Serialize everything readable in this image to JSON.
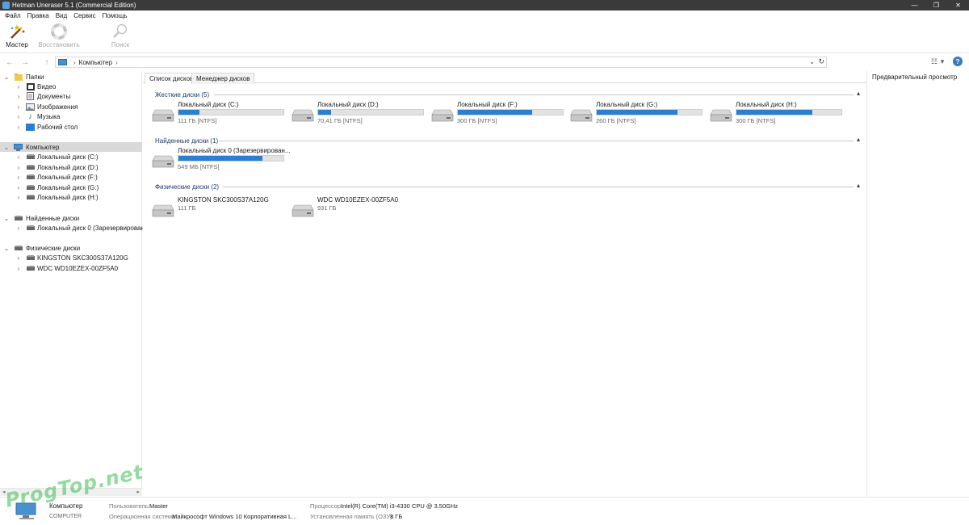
{
  "window": {
    "title": "Hetman Uneraser 5.1 (Commercial Edition)",
    "minimize_glyph": "—",
    "maximize_glyph": "❐",
    "close_glyph": "✕"
  },
  "menu": [
    "Файл",
    "Правка",
    "Вид",
    "Сервис",
    "Помощь"
  ],
  "toolbar": {
    "master_label": "Мастер",
    "restore_label": "Восстановить",
    "search_label": "Поиск"
  },
  "address": {
    "back_glyph": "←",
    "forward_glyph": "→",
    "up_glyph": "↑",
    "crumb": "Компьютер",
    "separator": "›",
    "dropdown_glyph": "⌄",
    "refresh_glyph": "↻",
    "view_glyph": "☷",
    "view_dropdown_glyph": "▾",
    "help_glyph": "?"
  },
  "sidebar": {
    "folders_label": "Папки",
    "folders": [
      "Видео",
      "Документы",
      "Изображения",
      "Музыка",
      "Рабочий стол"
    ],
    "computer_label": "Компьютер",
    "computer_disks": [
      "Локальный диск (C:)",
      "Локальный диск (D:)",
      "Локальный диск (F:)",
      "Локальный диск (G:)",
      "Локальный диск (H:)"
    ],
    "found_label": "Найденные диски",
    "found_disks": [
      "Локальный диск 0 (Зарезервировано"
    ],
    "physical_label": "Физические диски",
    "physical_disks": [
      "KINGSTON SKC300S37A120G",
      "WDC WD10EZEX-00ZF5A0"
    ],
    "expand_glyph": "›",
    "collapse_glyph": "⌄"
  },
  "tabs": [
    "Список дисков",
    "Менеджер дисков"
  ],
  "groups": {
    "hard_disks_title": "Жесткие диски (5)",
    "found_disks_title": "Найденные диски (1)",
    "physical_disks_title": "Физические диски (2)",
    "collapse_glyph": "▴"
  },
  "hard_disks": [
    {
      "name": "Локальный диск (C:)",
      "info": "111 ГБ [NTFS]",
      "fill": 0.2
    },
    {
      "name": "Локальный диск (D:)",
      "info": "70,41 ГБ [NTFS]",
      "fill": 0.12
    },
    {
      "name": "Локальный диск (F:)",
      "info": "300 ГБ [NTFS]",
      "fill": 0.71
    },
    {
      "name": "Локальный диск (G:)",
      "info": "260 ГБ [NTFS]",
      "fill": 0.77
    },
    {
      "name": "Локальный диск (H:)",
      "info": "300 ГБ [NTFS]",
      "fill": 0.72
    }
  ],
  "found_disks": [
    {
      "name": "Локальный диск 0 (Зарезервирован...",
      "info": "549 МБ [NTFS]",
      "fill": 0.8
    }
  ],
  "physical_disks": [
    {
      "name": "KINGSTON SKC300S37A120G",
      "info": "111 ГБ"
    },
    {
      "name": "WDC WD10EZEX-00ZF5A0",
      "info": "931 ГБ"
    }
  ],
  "preview": {
    "title": "Предварительный просмотр"
  },
  "scrollbar": {
    "left_glyph": "◂",
    "right_glyph": "▸"
  },
  "status": {
    "name": "Компьютер",
    "type": "COMPUTER",
    "user_label": "Пользователь:",
    "user_value": "Master",
    "os_label": "Операционная система:",
    "os_value": "Майкрософт Windows 10 Корпоративная L...",
    "cpu_label": "Процессор:",
    "cpu_value": "Intel(R) Core(TM) i3-4330 CPU @ 3.50GHz",
    "ram_label": "Установленная память (ОЗУ):",
    "ram_value": "8 ГБ"
  },
  "watermark": "ProgTop.net",
  "colors": {
    "titlebar": "#3a3a3a",
    "accent": "#2b7fd0",
    "selection": "#d9d9d9",
    "group_title": "#1f3c6b"
  }
}
